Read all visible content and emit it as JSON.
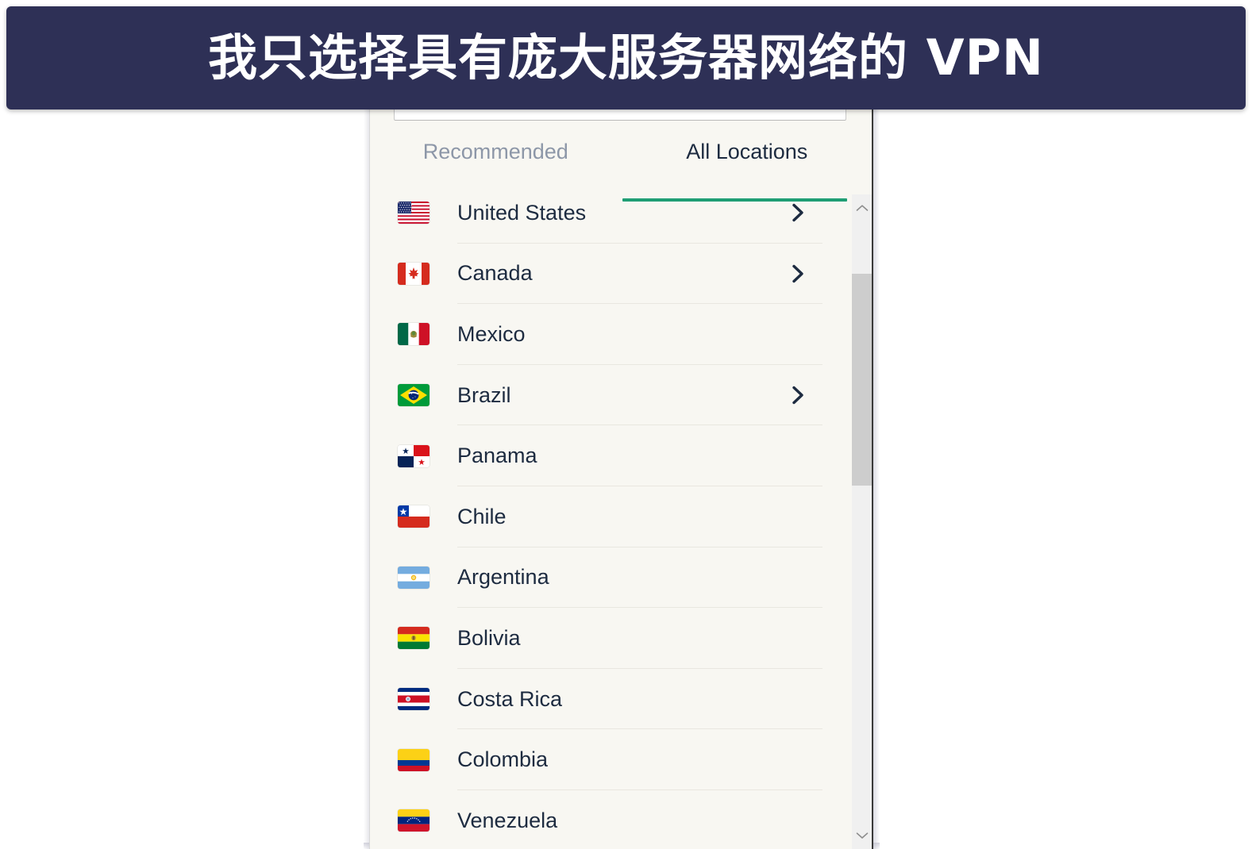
{
  "banner": {
    "title": "我只选择具有庞大服务器网络的 VPN",
    "background_color": "#2e3056",
    "text_color": "#ffffff"
  },
  "app": {
    "panel_background": "#f8f7f2",
    "accent_color": "#1f9e74",
    "search": {
      "value": "",
      "placeholder": ""
    },
    "tabs": [
      {
        "id": "recommended",
        "label": "Recommended",
        "active": false
      },
      {
        "id": "all_locations",
        "label": "All Locations",
        "active": true
      }
    ],
    "locations": [
      {
        "name": "United States",
        "flag": "flag-united-states",
        "expandable": true
      },
      {
        "name": "Canada",
        "flag": "flag-canada",
        "expandable": true
      },
      {
        "name": "Mexico",
        "flag": "flag-mexico",
        "expandable": false
      },
      {
        "name": "Brazil",
        "flag": "flag-brazil",
        "expandable": true
      },
      {
        "name": "Panama",
        "flag": "flag-panama",
        "expandable": false
      },
      {
        "name": "Chile",
        "flag": "flag-chile",
        "expandable": false
      },
      {
        "name": "Argentina",
        "flag": "flag-argentina",
        "expandable": false
      },
      {
        "name": "Bolivia",
        "flag": "flag-bolivia",
        "expandable": false
      },
      {
        "name": "Costa Rica",
        "flag": "flag-costa-rica",
        "expandable": false
      },
      {
        "name": "Colombia",
        "flag": "flag-colombia",
        "expandable": false
      },
      {
        "name": "Venezuela",
        "flag": "flag-venezuela",
        "expandable": false
      }
    ],
    "scrollbar": {
      "up_icon": "chevron-up-icon",
      "down_icon": "chevron-down-icon",
      "thumb_color": "#cdcdcd",
      "track_color": "#f0f0f0"
    },
    "row_chevron_icon": "chevron-right-icon"
  }
}
